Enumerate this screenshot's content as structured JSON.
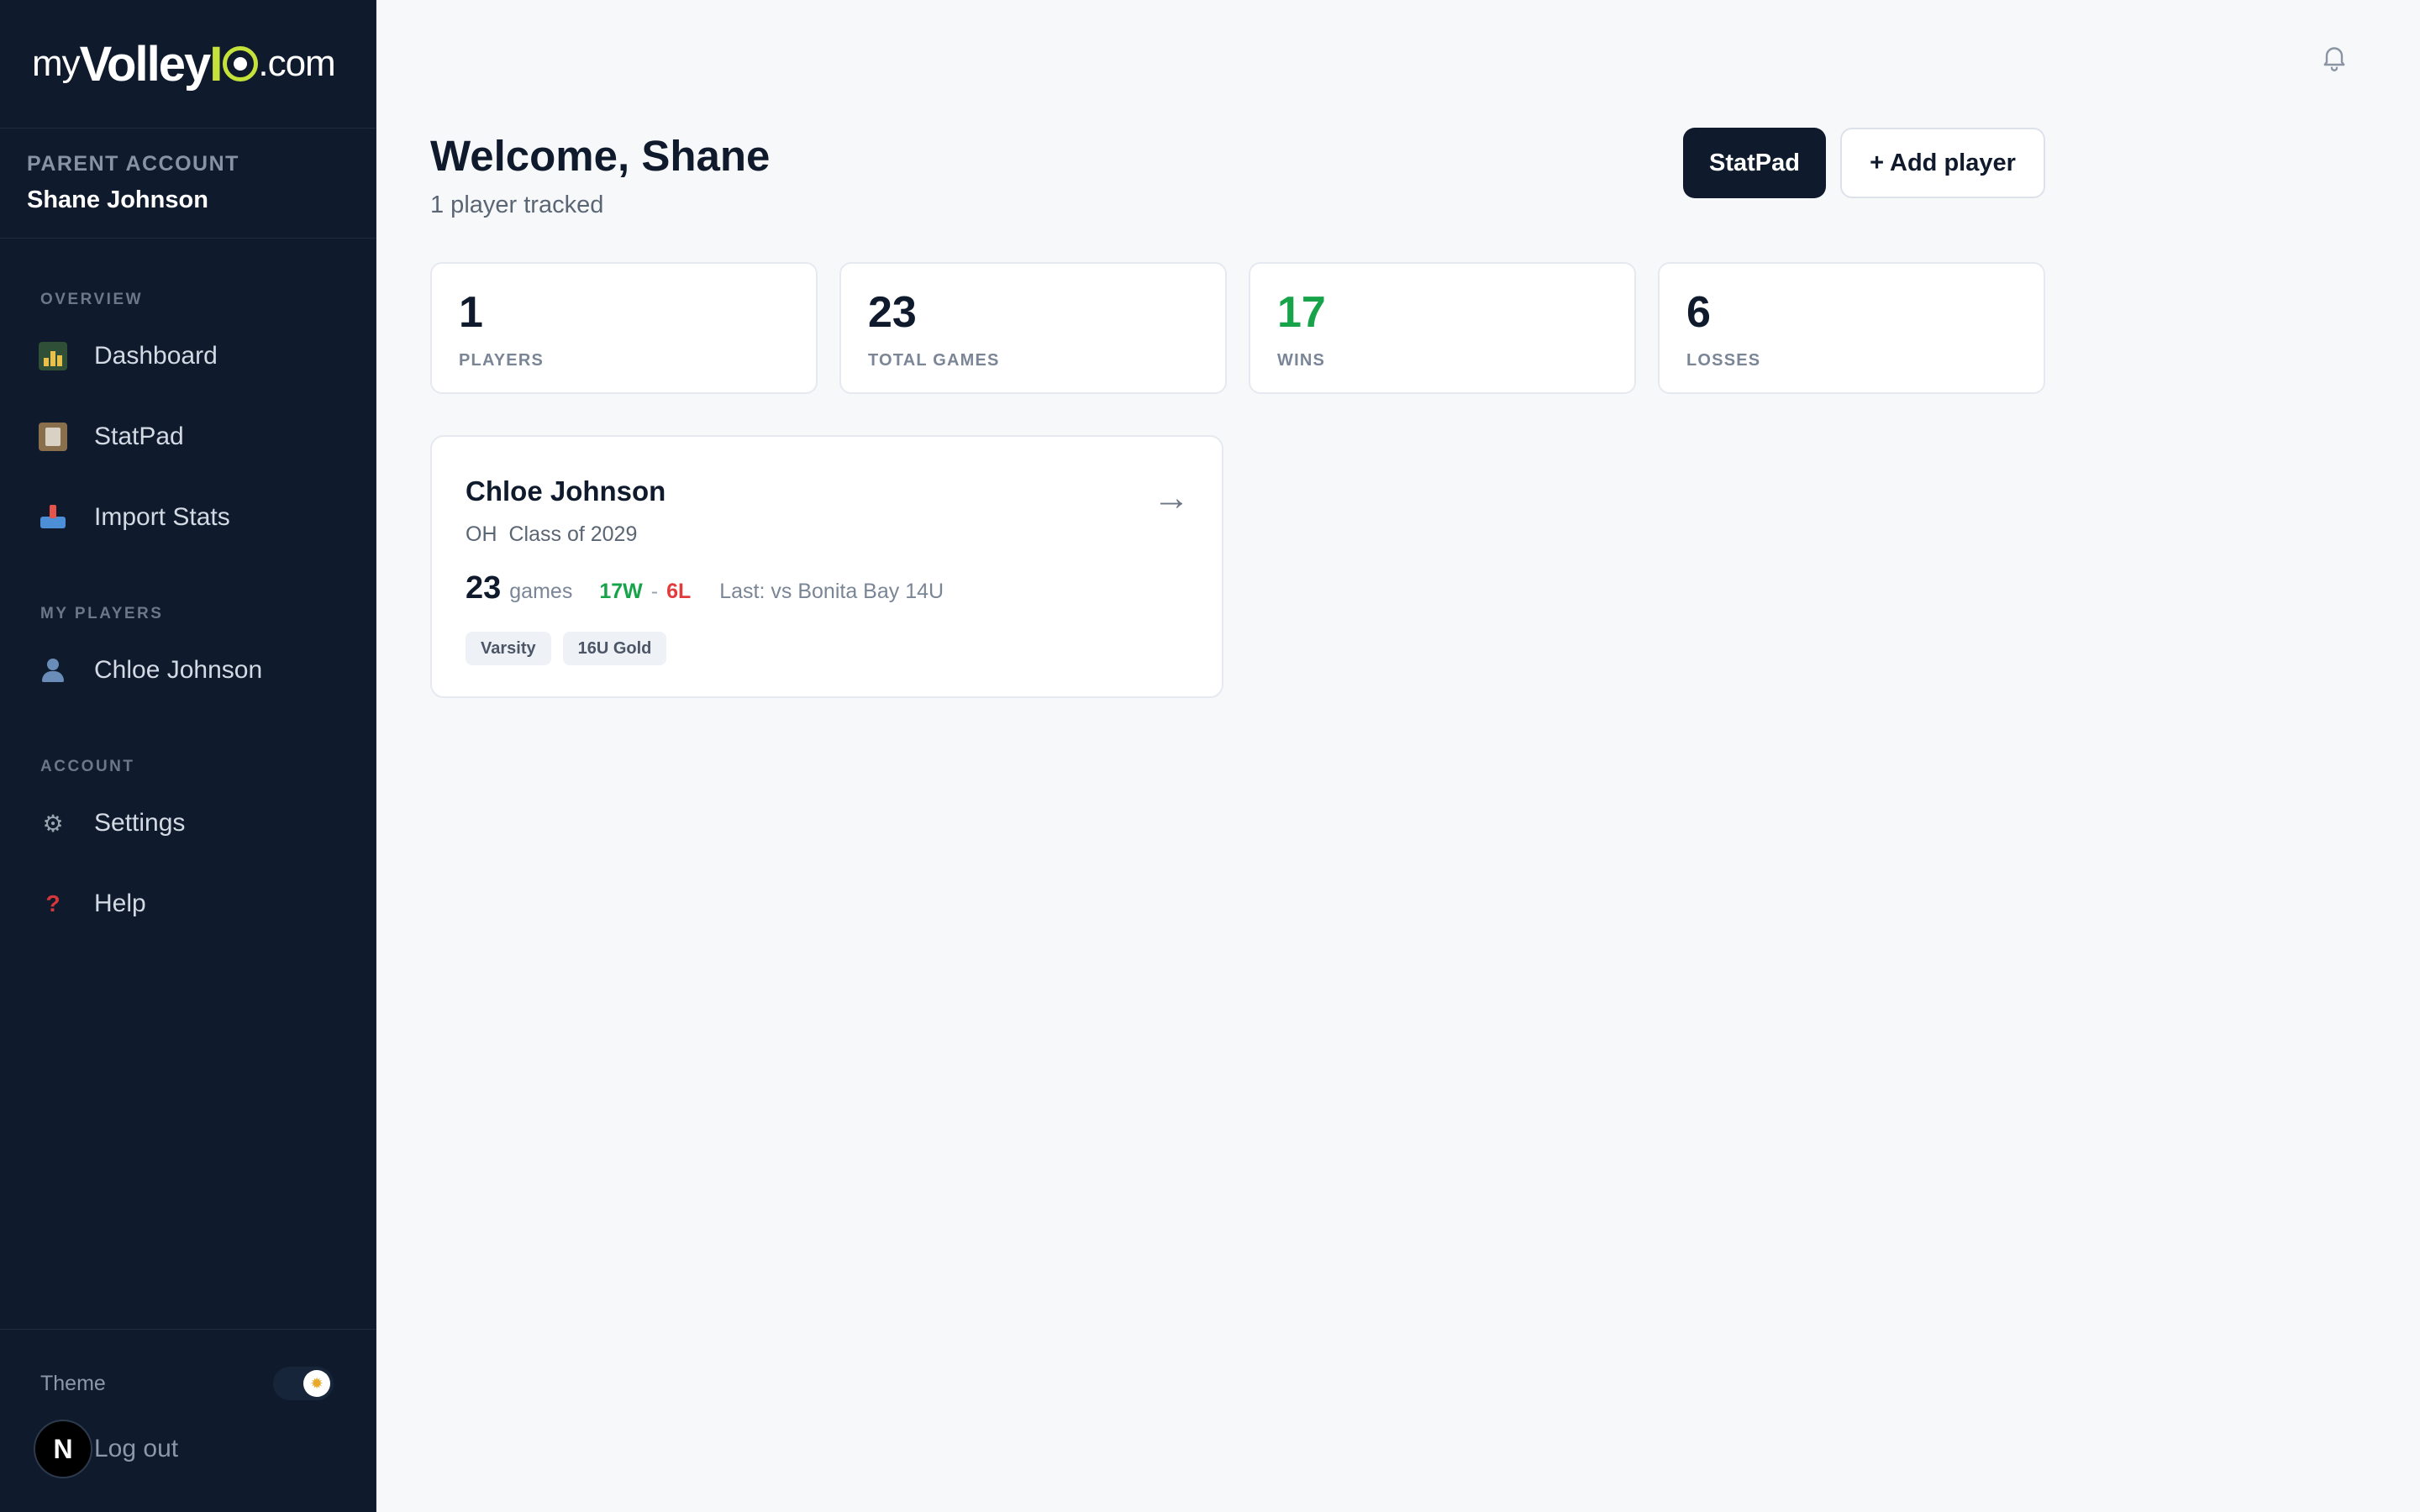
{
  "brand": {
    "my": "my",
    "volley": "Volley",
    "iq": "IQ",
    "com": ".com"
  },
  "account": {
    "label": "PARENT ACCOUNT",
    "name": "Shane Johnson"
  },
  "sidebar": {
    "sections": [
      {
        "title": "OVERVIEW"
      },
      {
        "title": "MY PLAYERS"
      },
      {
        "title": "ACCOUNT"
      }
    ],
    "items": [
      {
        "label": "Dashboard",
        "icon": "chart-icon"
      },
      {
        "label": "StatPad",
        "icon": "clipboard-icon"
      },
      {
        "label": "Import Stats",
        "icon": "inbox-tray-icon"
      },
      {
        "label": "Chloe Johnson",
        "icon": "user-icon"
      },
      {
        "label": "Settings",
        "icon": "gear-icon"
      },
      {
        "label": "Help",
        "icon": "question-icon"
      }
    ],
    "theme_label": "Theme",
    "avatar_initial": "N",
    "logout_label": "Log out"
  },
  "header": {
    "welcome": "Welcome, Shane",
    "subtitle": "1 player tracked",
    "statpad_button": "StatPad",
    "add_player_button": "+ Add player"
  },
  "stats": [
    {
      "value": "1",
      "label": "PLAYERS"
    },
    {
      "value": "23",
      "label": "TOTAL GAMES"
    },
    {
      "value": "17",
      "label": "WINS"
    },
    {
      "value": "6",
      "label": "LOSSES"
    }
  ],
  "player": {
    "name": "Chloe Johnson",
    "position": "OH",
    "class": "Class of 2029",
    "games": "23",
    "games_label": "games",
    "wins": "17W",
    "separator": "-",
    "losses": "6L",
    "last": "Last: vs Bonita Bay 14U",
    "tags": [
      "Varsity",
      "16U Gold"
    ],
    "arrow": "→"
  },
  "colors": {
    "sidebar_bg": "#0f1b2d",
    "accent_lime": "#c5e23a",
    "win_green": "#17a34a",
    "loss_red": "#e23b3b",
    "page_bg": "#f7f8fa"
  }
}
